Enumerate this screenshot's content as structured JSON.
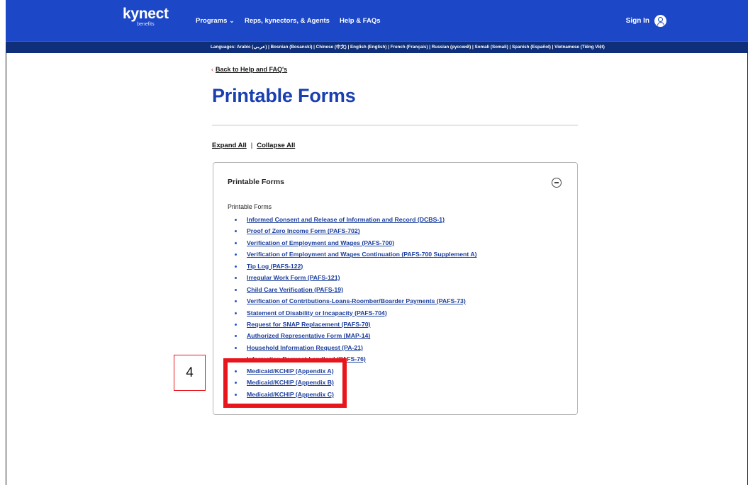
{
  "header": {
    "logo_text": "kynect",
    "logo_subtext": "benefits",
    "nav": [
      "Programs ⌄",
      "Reps, kynectors, & Agents",
      "Help & FAQs"
    ],
    "signin_label": "Sign In"
  },
  "languages_text": "Languages: Arabic (عربي) | Bosnian (Bosanski) | Chinese (中文) | English (English) | French (Français) | Russian (русский) | Somali (Somali) | Spanish (Español) | Vietnamese (Tiếng Việt)",
  "back_link": "Back to Help and FAQ's",
  "page_title": "Printable Forms",
  "expand_all": "Expand All",
  "separator": "|",
  "collapse_all": "Collapse All",
  "card": {
    "title": "Printable Forms",
    "section_label": "Printable Forms",
    "forms": [
      "Informed Consent and Release of Information and Record (DCBS-1)",
      "Proof of Zero Income Form (PAFS-702)",
      "Verification of Employment and Wages (PAFS-700)",
      "Verification of Employment and Wages Continuation (PAFS-700 Supplement A)",
      "Tip Log (PAFS-122)",
      "Irregular Work Form (PAFS-121)",
      "Child Care Verification (PAFS-19)",
      "Verification of Contributions-Loans-Roomber/Boarder Payments (PAFS-73)",
      "Statement of Disability or Incapacity (PAFS-704)",
      "Request for SNAP Replacement (PAFS-70)",
      "Authorized Representative Form (MAP-14)",
      "Household Information Request (PA-21)",
      "Information Request-Landlord (PAFS-76)",
      "Medicaid/KCHIP (Appendix A)",
      "Medicaid/KCHIP (Appendix B)",
      "Medicaid/KCHIP (Appendix C)"
    ]
  },
  "annotation": {
    "step_number": "4",
    "highlight_color": "#e8161c"
  },
  "colors": {
    "brand_blue": "#1c47c6",
    "language_bar": "#0f2f7a",
    "title_blue": "#1a3fb0",
    "link_blue": "#1c3f9c"
  }
}
